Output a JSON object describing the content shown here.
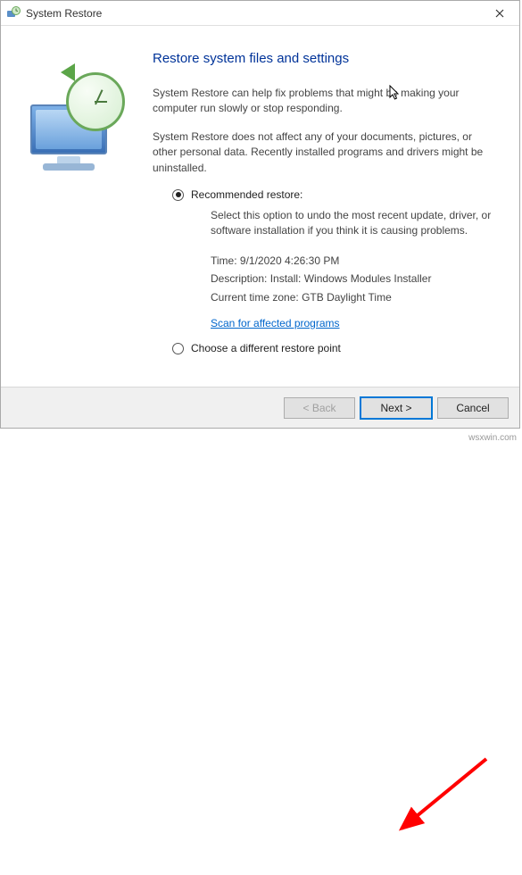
{
  "window": {
    "title": "System Restore"
  },
  "heading": "Restore system files and settings",
  "intro1": "System Restore can help fix problems that might be making your computer run slowly or stop responding.",
  "intro2": "System Restore does not affect any of your documents, pictures, or other personal data. Recently installed programs and drivers might be uninstalled.",
  "option_recommended": {
    "label": "Recommended restore:",
    "desc": "Select this option to undo the most recent update, driver, or software installation if you think it is causing problems.",
    "time_label": "Time:",
    "time_value": "9/1/2020 4:26:30 PM",
    "desc_label": "Description:",
    "desc_value": "Install: Windows Modules Installer",
    "tz_label": "Current time zone:",
    "tz_value": "GTB Daylight Time",
    "scan_link": "Scan for affected programs"
  },
  "option_choose": {
    "label": "Choose a different restore point"
  },
  "buttons": {
    "back": "< Back",
    "next": "Next >",
    "cancel": "Cancel"
  },
  "watermark": "wsxwin.com"
}
